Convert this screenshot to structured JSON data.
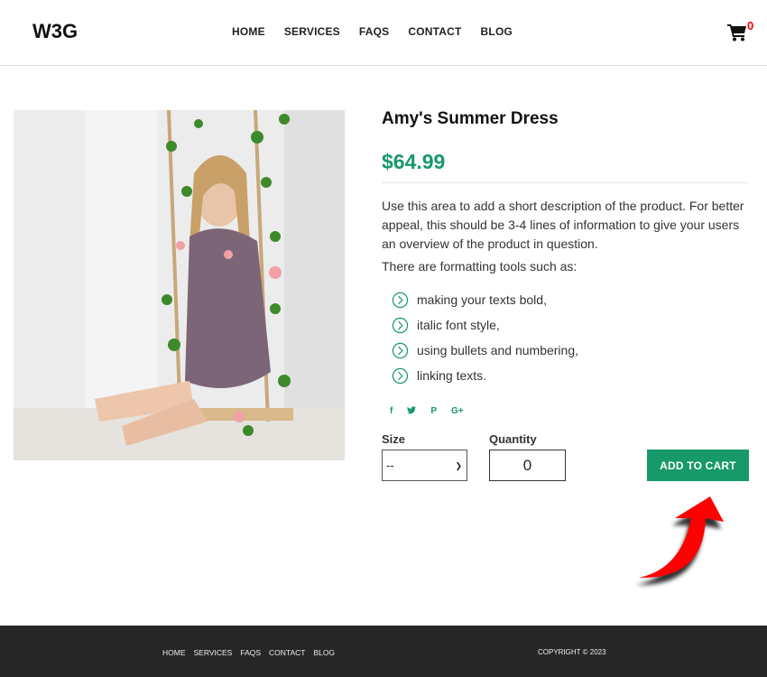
{
  "header": {
    "logo": "W3G",
    "nav": [
      "HOME",
      "SERVICES",
      "FAQS",
      "CONTACT",
      "BLOG"
    ],
    "cart_icon": "shopping-cart-icon",
    "cart_count": "0"
  },
  "product": {
    "image_alt": "Woman in floral summer dress sitting on a rope swing decorated with flowers",
    "title": "Amy's Summer Dress",
    "price": "$64.99",
    "description": "Use this area to add a short description of the product. For better appeal, this should be 3-4 lines of information to give your users an overview of the product in question.",
    "formatting_intro": "There are formatting tools such as:",
    "bullets": [
      "making your texts bold,",
      "italic font style,",
      "using bullets and numbering,",
      "linking texts."
    ],
    "bullet_icon": "circle-chevron-right-icon",
    "social": [
      {
        "icon": "facebook-icon",
        "glyph": "f"
      },
      {
        "icon": "twitter-icon",
        "glyph": "🐦"
      },
      {
        "icon": "pinterest-icon",
        "glyph": "P"
      },
      {
        "icon": "google-plus-icon",
        "glyph": "G+"
      }
    ],
    "size_label": "Size",
    "size_selected": "--",
    "quantity_label": "Quantity",
    "quantity_value": "0",
    "add_to_cart_label": "ADD TO CART"
  },
  "annotation": {
    "arrow_icon": "red-curved-arrow-icon",
    "arrow_color": "#ff0000"
  },
  "footer": {
    "nav": [
      "HOME",
      "SERVICES",
      "FAQS",
      "CONTACT",
      "BLOG"
    ],
    "copyright": "COPYRIGHT © 2023"
  },
  "colors": {
    "accent": "#17996a",
    "cart_badge": "#ee0000",
    "footer_bg": "#262626"
  }
}
